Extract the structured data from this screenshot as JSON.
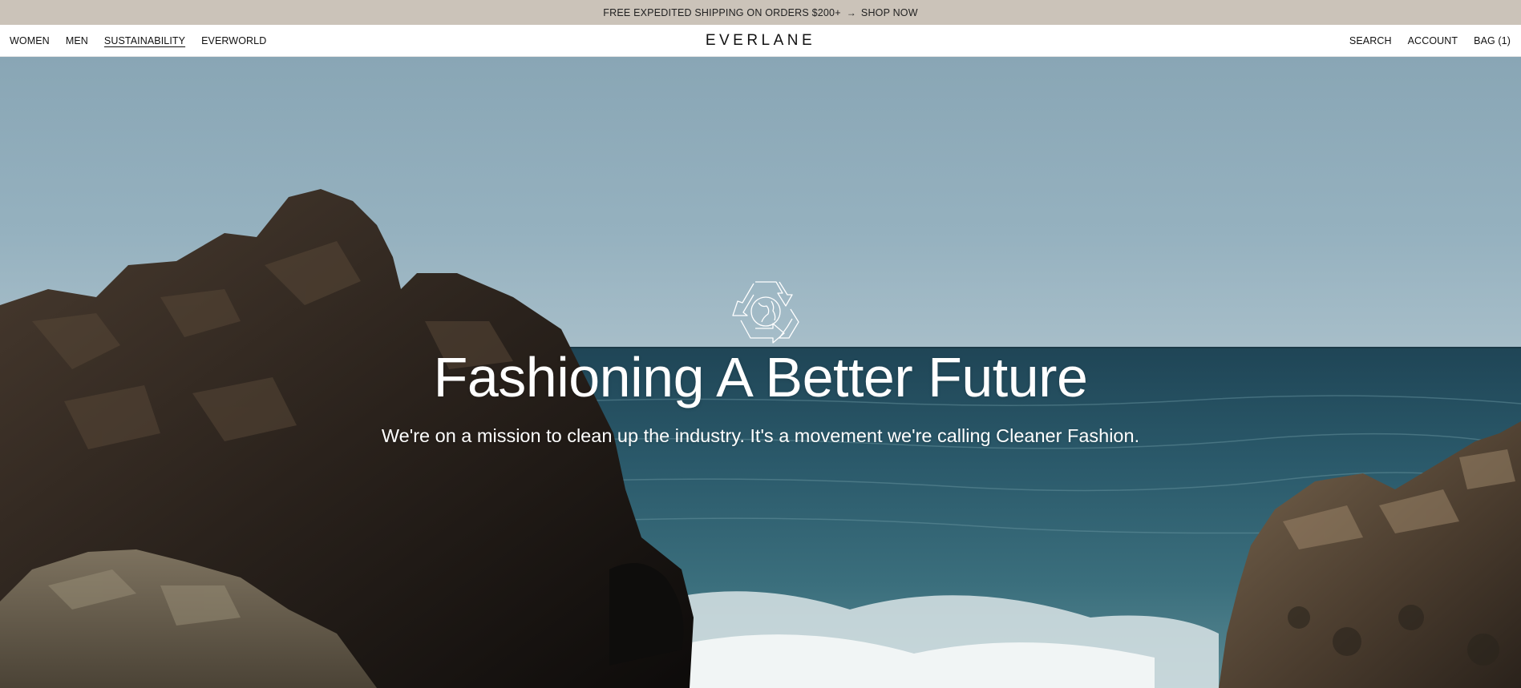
{
  "promo": {
    "text": "FREE EXPEDITED SHIPPING ON ORDERS $200+",
    "arrow": "→",
    "link": "SHOP NOW"
  },
  "nav": {
    "left": [
      {
        "label": "WOMEN",
        "active": false
      },
      {
        "label": "MEN",
        "active": false
      },
      {
        "label": "SUSTAINABILITY",
        "active": true
      },
      {
        "label": "EVERWORLD",
        "active": false
      }
    ],
    "logo": "EVERLANE",
    "right": [
      {
        "label": "SEARCH"
      },
      {
        "label": "ACCOUNT"
      },
      {
        "label": "BAG (1)"
      }
    ]
  },
  "hero": {
    "icon": "recycle-globe-icon",
    "title": "Fashioning A Better Future",
    "subtitle": "We're on a mission to clean up the industry. It's a movement we're calling Cleaner Fashion."
  },
  "colors": {
    "promo_bg": "#cbc3b9",
    "sky": "#8ea9b6",
    "sea": "#2a5566",
    "rock": "#2e2721",
    "text_on_hero": "#ffffff"
  }
}
